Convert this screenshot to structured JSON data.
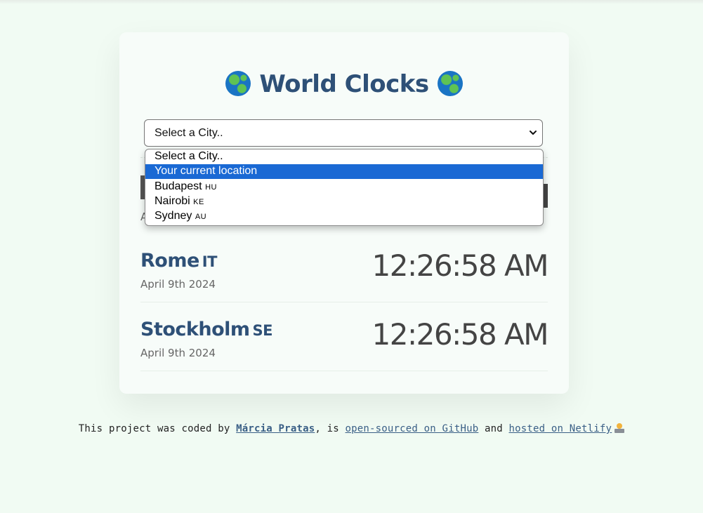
{
  "header": {
    "title": "World Clocks"
  },
  "select": {
    "current_value": "Select a City..",
    "options": [
      {
        "label": "Select a City..",
        "code": ""
      },
      {
        "label": "Your current location",
        "code": ""
      },
      {
        "label": "Budapest",
        "code": "HU"
      },
      {
        "label": "Nairobi",
        "code": "KE"
      },
      {
        "label": "Sydney",
        "code": "AU"
      }
    ],
    "highlighted_index": 1
  },
  "partial_row": {
    "date_fragment": "A"
  },
  "cities": [
    {
      "name": "Rome",
      "code": "IT",
      "date": "April 9th 2024",
      "time": "12:26:58 AM"
    },
    {
      "name": "Stockholm",
      "code": "SE",
      "date": "April 9th 2024",
      "time": "12:26:58 AM"
    }
  ],
  "footer": {
    "prefix": "This project was coded by ",
    "author": "Márcia Pratas",
    "middle1": ", is ",
    "github_link": "open-sourced on GitHub",
    "middle2": " and ",
    "netlify_link": "hosted on Netlify"
  },
  "icons": {
    "title_left": "globe-americas-icon",
    "title_right": "globe-americas-icon",
    "select_caret": "chevron-down-icon",
    "footer": "technologist-icon"
  },
  "colors": {
    "background": "#f1fbf3",
    "card": "#f7fcf9",
    "title": "#2e5077",
    "time": "#444444",
    "highlight": "#1a69d4",
    "link": "#3a5f86"
  }
}
